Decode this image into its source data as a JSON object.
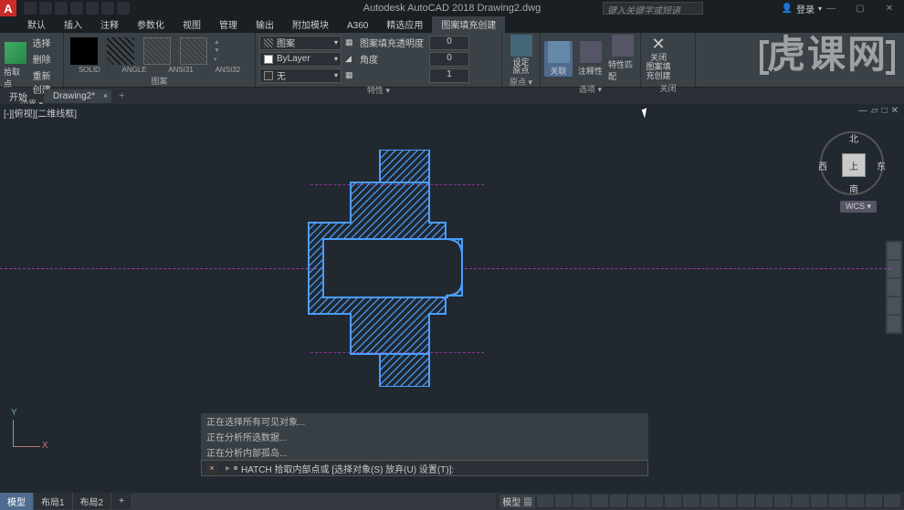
{
  "app": {
    "title": "Autodesk AutoCAD 2018   Drawing2.dwg",
    "logo": "A"
  },
  "search": {
    "placeholder": "键入关键字或短语"
  },
  "login": {
    "label": "登录"
  },
  "window": {
    "min": "—",
    "max": "▢",
    "close": "✕"
  },
  "tabs": {
    "items": [
      "默认",
      "插入",
      "注释",
      "参数化",
      "视图",
      "管理",
      "输出",
      "附加模块",
      "A360",
      "精选应用",
      "图案填充创建"
    ],
    "active": 10
  },
  "ribbon": {
    "boundaries": {
      "label": "边界 ▾",
      "pick": "拾取点",
      "select": "选择",
      "remove": "删除",
      "recreate": "重新创建"
    },
    "pattern": {
      "label": "图案",
      "items": [
        "SOLID",
        "ANGLE",
        "ANSI31",
        "ANSI32"
      ]
    },
    "properties": {
      "label": "特性 ▾",
      "row1": {
        "dd": "图案",
        "lbl": "图案填充透明度",
        "val": "0"
      },
      "row2": {
        "dd": "ByLayer",
        "lbl": "角度",
        "val": "0"
      },
      "row3": {
        "dd": "无",
        "lbl": "",
        "val": "1",
        "icon": "▦"
      }
    },
    "origin": {
      "label": "原点 ▾",
      "btn": "设定\n原点"
    },
    "options": {
      "label": "选项 ▾",
      "assoc": "关联",
      "annot": "注释性",
      "match": "特性匹配"
    },
    "close": {
      "label": "关闭",
      "btn1": "关闭",
      "btn2": "图案填充创建"
    }
  },
  "doctabs": {
    "items": [
      "开始",
      "Drawing2*"
    ],
    "active": 1
  },
  "view": {
    "label": "[-][俯视][二维线框]",
    "ctrls": {
      "min": "—",
      "restore": "▱",
      "max": "□",
      "close": "✕"
    },
    "cube": {
      "top": "上",
      "n": "北",
      "s": "南",
      "e": "东",
      "w": "西"
    },
    "wcs": "WCS ▾"
  },
  "ucs": {
    "x": "X",
    "y": "Y"
  },
  "cmd": {
    "log": [
      "正在选择所有可见对象...",
      "正在分析所选数据...",
      "正在分析内部孤岛..."
    ],
    "prefix": "▸",
    "text": "HATCH 拾取内部点或 [选择对象(S) 放弃(U) 设置(T)]:",
    "close": "×"
  },
  "layout": {
    "tabs": [
      "模型",
      "布局1",
      "布局2"
    ],
    "active": 0,
    "plus": "+"
  },
  "status": {
    "model": "模型 ▦"
  },
  "watermark": "虎课网"
}
